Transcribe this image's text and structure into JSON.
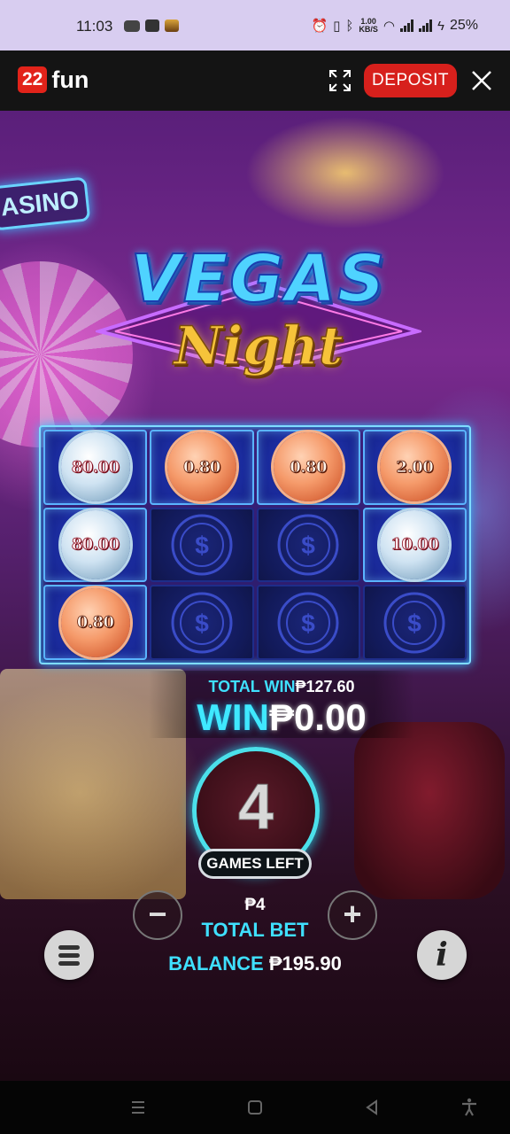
{
  "status_bar": {
    "time": "11:03",
    "net_speed_value": "1.00",
    "net_speed_unit": "KB/S",
    "battery": "25%"
  },
  "header": {
    "logo_badge": "22",
    "logo_text": "fun",
    "deposit_label": "DEPOSIT",
    "brand_color": "#e2231a"
  },
  "game": {
    "title_top": "VEGAS",
    "title_bottom": "Night",
    "grid": [
      [
        {
          "type": "silver",
          "value": "80.00"
        },
        {
          "type": "copper",
          "value": "0.80"
        },
        {
          "type": "copper",
          "value": "0.80"
        },
        {
          "type": "copper",
          "value": "2.00"
        }
      ],
      [
        {
          "type": "silver",
          "value": "80.00"
        },
        {
          "type": "empty",
          "value": ""
        },
        {
          "type": "empty",
          "value": ""
        },
        {
          "type": "silver",
          "value": "10.00"
        }
      ],
      [
        {
          "type": "copper",
          "value": "0.80"
        },
        {
          "type": "empty",
          "value": ""
        },
        {
          "type": "empty",
          "value": ""
        },
        {
          "type": "empty",
          "value": ""
        }
      ]
    ],
    "total_win_label": "TOTAL WIN",
    "total_win_value": "₱127.60",
    "win_label": "WIN",
    "win_value": "₱0.00",
    "games_left_count": "4",
    "games_left_label": "GAMES LEFT",
    "bet_minus": "−",
    "bet_plus": "+",
    "bet_amount": "₱4",
    "total_bet_label": "TOTAL BET",
    "balance_label": "BALANCE",
    "balance_value": "₱195.90",
    "info_glyph": "i"
  }
}
